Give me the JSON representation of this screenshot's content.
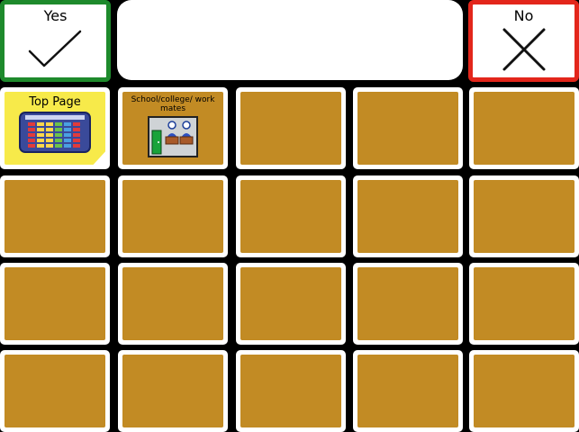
{
  "yes_button": {
    "label": "Yes",
    "icon": "check-icon",
    "border_color": "#1e8a2c"
  },
  "no_button": {
    "label": "No",
    "icon": "close-icon",
    "border_color": "#e3261b"
  },
  "message_bar": {
    "text": ""
  },
  "grid": {
    "top_page": {
      "label": "Top Page",
      "icon": "grid-page-icon"
    },
    "school": {
      "label": "School/college/ work mates",
      "icon": "classroom-icon"
    },
    "empty_cell_color": "#c28b24"
  }
}
